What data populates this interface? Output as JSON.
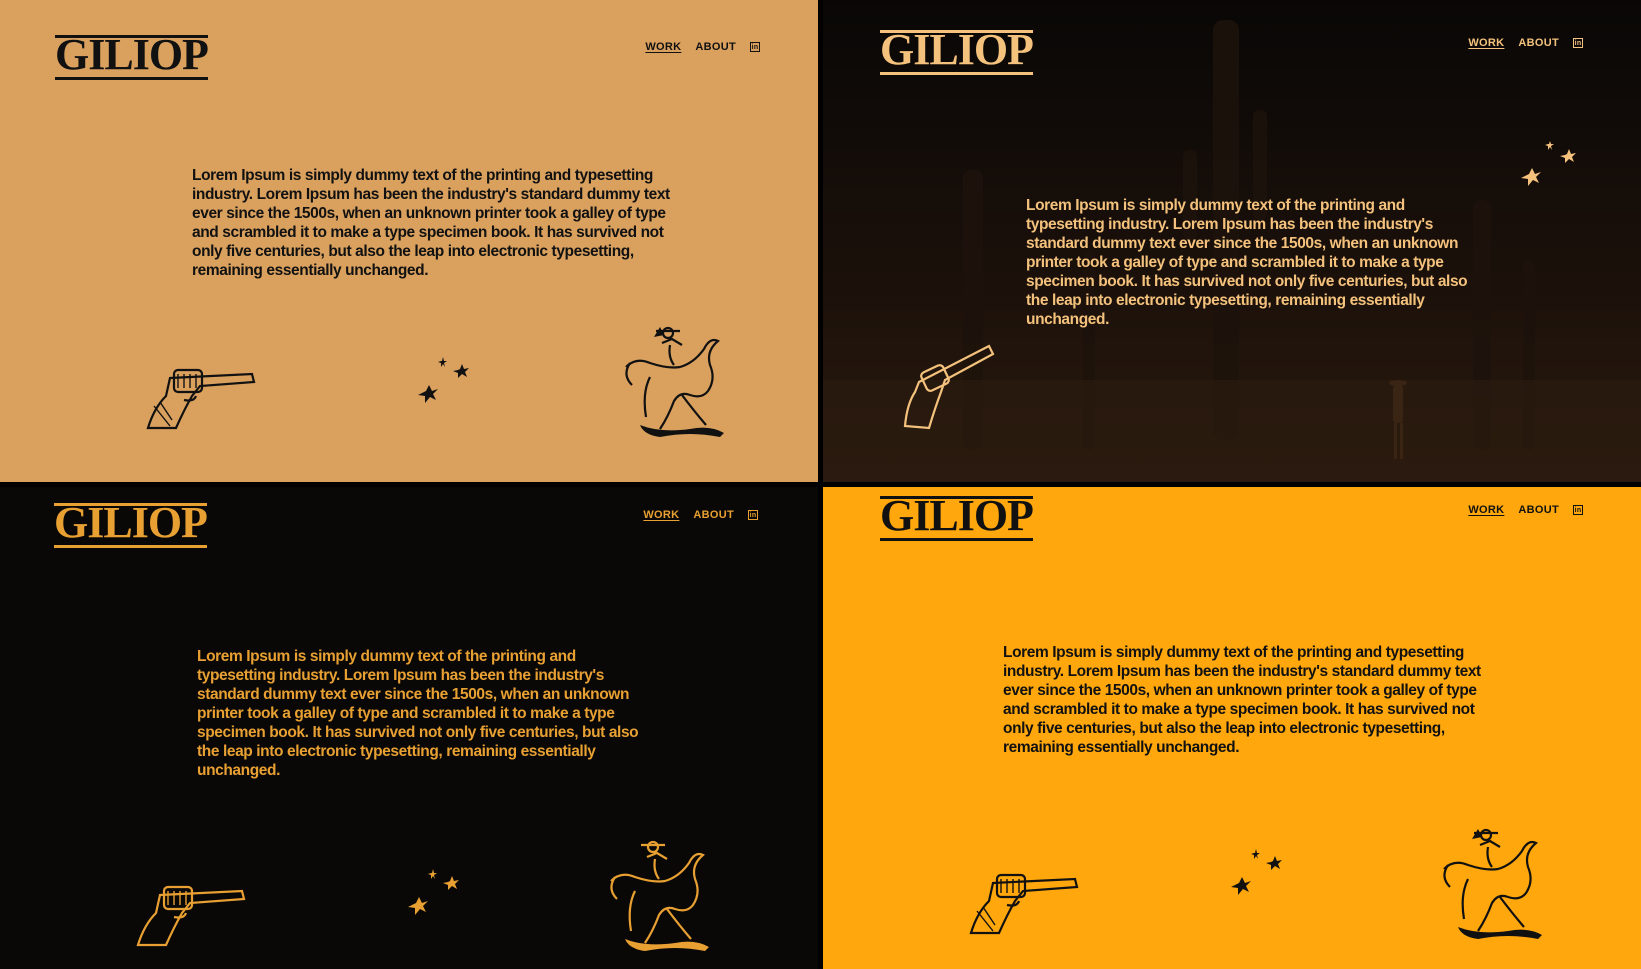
{
  "brand": {
    "logo": "GILIOP"
  },
  "nav": {
    "work": "WORK",
    "about": "ABOUT",
    "linkedin": "in"
  },
  "body_text": "Lorem Ipsum is simply dummy text of the printing and typesetting industry. Lorem Ipsum has been the industry's standard dummy text ever since the 1500s, when an unknown printer took a galley of type and scrambled it to make a type specimen book. It has survived not only five centuries, but also the leap into electronic typesetting, remaining essentially unchanged.",
  "colors": {
    "tan": "#D9A05E",
    "dark": "#0A0806",
    "orange": "#E8A033",
    "amber": "#FFA70C",
    "ink": "#111111",
    "light_ink": "#F4C27C"
  },
  "icons": [
    "revolver-icon",
    "spark-icon",
    "bronco-rider-icon",
    "linkedin-icon"
  ]
}
